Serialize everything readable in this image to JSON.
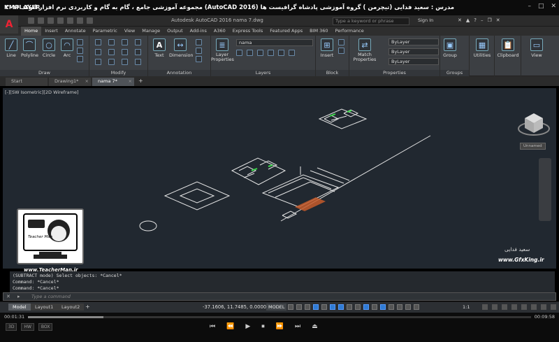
{
  "player": {
    "logo": "KMPLAYER",
    "title": "مجموعه آموزشی جامع ، گام به گام و کاربردی نرم افزار  اتوکد ۲۰۱۶ (AutoCAD 2016)  مدرس : سعید فدایی (تیچرمن ) گروه آموزشی پادشاه گرافیست ها",
    "controls": {
      "minimize": "–",
      "maximize": "□",
      "close": "✕"
    },
    "time_current": "00:01:31",
    "time_total": "00:09:58",
    "progress": 0.15,
    "buttons": [
      "⏮",
      "⏪",
      "▶",
      "⏹",
      "⏩",
      "⏭",
      "⏏"
    ],
    "left_badges": [
      "3D",
      "HW",
      "BOX"
    ]
  },
  "acad": {
    "app_letter": "A",
    "window_title": "Autodesk AutoCAD 2016   nama 7.dwg",
    "search_placeholder": "Type a keyword or phrase",
    "sign_in": "Sign In",
    "ribbon_tabs": [
      "Home",
      "Insert",
      "Annotate",
      "Parametric",
      "View",
      "Manage",
      "Output",
      "Add-ins",
      "A360",
      "Express Tools",
      "Featured Apps",
      "BIM 360",
      "Performance"
    ],
    "active_ribbon_tab": "Home",
    "panels": {
      "draw": {
        "label": "Draw",
        "tools": [
          "Line",
          "Polyline",
          "Circle",
          "Arc"
        ]
      },
      "modify": {
        "label": "Modify"
      },
      "annotation": {
        "label": "Annotation",
        "tools": [
          "Text",
          "Dimension"
        ]
      },
      "layers": {
        "label": "Layers",
        "tool": "Layer Properties",
        "current_layer": "nama"
      },
      "block": {
        "label": "Block",
        "tool": "Insert"
      },
      "properties": {
        "label": "Properties",
        "tool": "Match Properties",
        "color": "ByLayer",
        "linetype": "ByLayer",
        "lineweight": "ByLayer"
      },
      "groups": {
        "label": "Groups",
        "tool": "Group"
      },
      "utilities": {
        "tool": "Utilities"
      },
      "clipboard": {
        "tool": "Clipboard"
      },
      "view": {
        "tool": "View"
      }
    },
    "doc_tabs": [
      {
        "label": "Start",
        "active": false
      },
      {
        "label": "Drawing1*",
        "active": false
      },
      {
        "label": "nama 7*",
        "active": true
      }
    ],
    "viewport_label": "[-][SW Isometric][2D Wireframe]",
    "viewcube_badge": "Unnamed",
    "command_history": [
      "(SUBTRACT mode) Select objects: *Cancel*",
      "Command: *Cancel*",
      "Command: *Cancel*"
    ],
    "command_placeholder": "Type a command",
    "layout_tabs": [
      "Model",
      "Layout1",
      "Layout2"
    ],
    "coordinates": "-37.1606, 11.7485, 0.0000",
    "model_label": "MODEL",
    "scale": "1:1"
  },
  "watermark": {
    "name": "سعید فدایی",
    "site": "www.GfxKing.ir",
    "teacher_site": "www.TeacherMan.ir",
    "teacher_card_text": "Teacher Man"
  },
  "colors": {
    "accent": "#2f7bd4",
    "canvas": "#212830",
    "ribbon": "#3c3f43"
  }
}
